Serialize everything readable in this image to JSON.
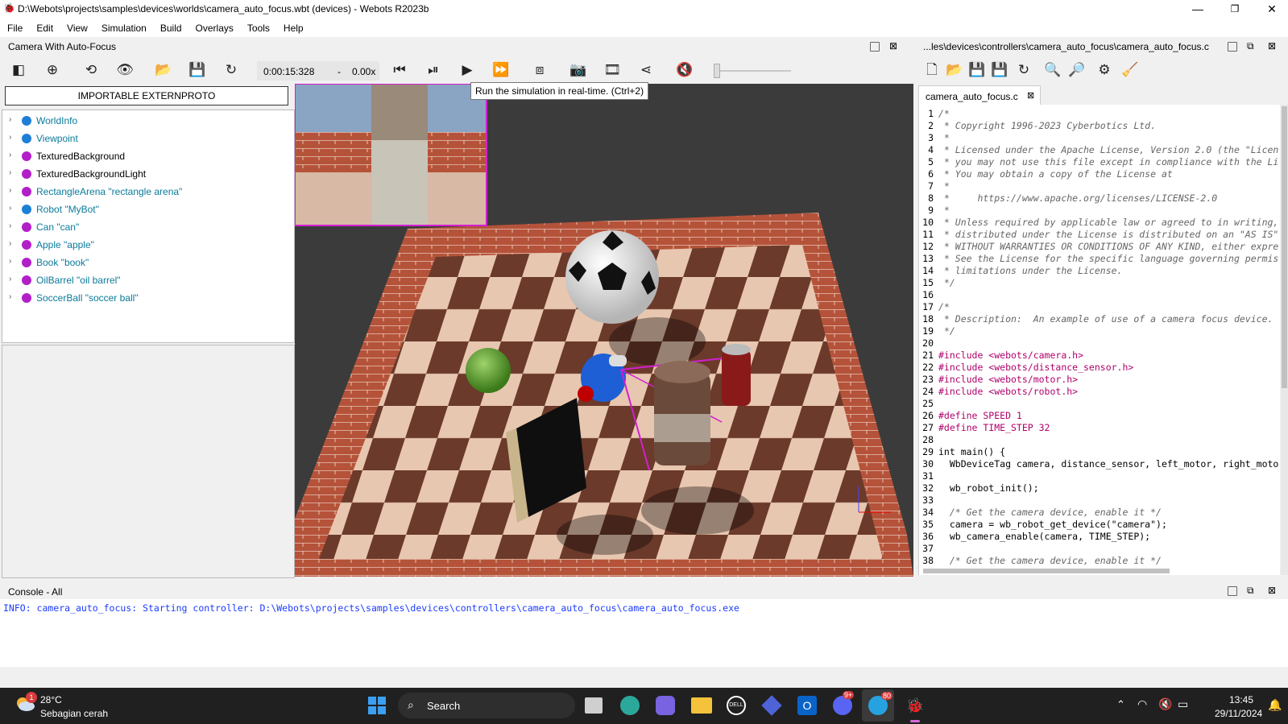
{
  "window": {
    "title": "D:\\Webots\\projects\\samples\\devices\\worlds\\camera_auto_focus.wbt (devices) - Webots R2023b",
    "minimize": "—",
    "maximize": "❐",
    "close": "✕"
  },
  "menu": [
    "File",
    "Edit",
    "View",
    "Simulation",
    "Build",
    "Overlays",
    "Tools",
    "Help"
  ],
  "scene_panel": {
    "title": "Camera With Auto-Focus",
    "importable_button": "IMPORTABLE EXTERNPROTO",
    "items": [
      {
        "label": "WorldInfo",
        "color": "#1e7fd6",
        "text_color": "#0a7a9a"
      },
      {
        "label": "Viewpoint",
        "color": "#1e7fd6",
        "text_color": "#0a7a9a"
      },
      {
        "label": "TexturedBackground",
        "color": "#b21fc9",
        "text_color": "#000000"
      },
      {
        "label": "TexturedBackgroundLight",
        "color": "#b21fc9",
        "text_color": "#000000"
      },
      {
        "label": "RectangleArena \"rectangle arena\"",
        "color": "#b21fc9",
        "text_color": "#0a7a9a"
      },
      {
        "label": "Robot \"MyBot\"",
        "color": "#1e7fd6",
        "text_color": "#0a7a9a"
      },
      {
        "label": "Can \"can\"",
        "color": "#b21fc9",
        "text_color": "#0a7a9a"
      },
      {
        "label": "Apple \"apple\"",
        "color": "#b21fc9",
        "text_color": "#0a7a9a"
      },
      {
        "label": "Book \"book\"",
        "color": "#b21fc9",
        "text_color": "#0a7a9a"
      },
      {
        "label": "OilBarrel \"oil barrel\"",
        "color": "#b21fc9",
        "text_color": "#0a7a9a"
      },
      {
        "label": "SoccerBall \"soccer ball\"",
        "color": "#b21fc9",
        "text_color": "#0a7a9a"
      }
    ]
  },
  "toolbar": {
    "time": "0:00:15:328",
    "separator": "-",
    "speed": "0.00x",
    "tooltip": "Run the simulation in real-time. (Ctrl+2)",
    "volume_level": 0.0
  },
  "editor": {
    "path": "...les\\devices\\controllers\\camera_auto_focus\\camera_auto_focus.c",
    "tab": "camera_auto_focus.c",
    "lines": [
      {
        "n": "1",
        "t": "/*",
        "k": "cm"
      },
      {
        "n": "2",
        "t": " * Copyright 1996-2023 Cyberbotics Ltd.",
        "k": "cm"
      },
      {
        "n": "3",
        "t": " *",
        "k": "cm"
      },
      {
        "n": "4",
        "t": " * Licensed under the Apache License, Version 2.0 (the \"Licen",
        "k": "cm"
      },
      {
        "n": "5",
        "t": " * you may not use this file except in compliance with the Li",
        "k": "cm"
      },
      {
        "n": "6",
        "t": " * You may obtain a copy of the License at",
        "k": "cm"
      },
      {
        "n": "7",
        "t": " *",
        "k": "cm"
      },
      {
        "n": "8",
        "t": " *     https://www.apache.org/licenses/LICENSE-2.0",
        "k": "cm"
      },
      {
        "n": "9",
        "t": " *",
        "k": "cm"
      },
      {
        "n": "10",
        "t": " * Unless required by applicable law or agreed to in writing,",
        "k": "cm"
      },
      {
        "n": "11",
        "t": " * distributed under the License is distributed on an \"AS IS\"",
        "k": "cm"
      },
      {
        "n": "12",
        "t": " * WITHOUT WARRANTIES OR CONDITIONS OF ANY KIND, either expre",
        "k": "cm"
      },
      {
        "n": "13",
        "t": " * See the License for the specific language governing permis",
        "k": "cm"
      },
      {
        "n": "14",
        "t": " * limitations under the License.",
        "k": "cm"
      },
      {
        "n": "15",
        "t": " */",
        "k": "cm"
      },
      {
        "n": "16",
        "t": "",
        "k": ""
      },
      {
        "n": "17",
        "t": "/*",
        "k": "cm"
      },
      {
        "n": "18",
        "t": " * Description:  An example of use of a camera focus device.",
        "k": "cm"
      },
      {
        "n": "19",
        "t": " */",
        "k": "cm"
      },
      {
        "n": "20",
        "t": "",
        "k": ""
      },
      {
        "n": "21",
        "t": "#include <webots/camera.h>",
        "k": "pp"
      },
      {
        "n": "22",
        "t": "#include <webots/distance_sensor.h>",
        "k": "pp"
      },
      {
        "n": "23",
        "t": "#include <webots/motor.h>",
        "k": "pp"
      },
      {
        "n": "24",
        "t": "#include <webots/robot.h>",
        "k": "pp"
      },
      {
        "n": "25",
        "t": "",
        "k": ""
      },
      {
        "n": "26",
        "t": "#define SPEED 1",
        "k": "pp"
      },
      {
        "n": "27",
        "t": "#define TIME_STEP 32",
        "k": "pp"
      },
      {
        "n": "28",
        "t": "",
        "k": ""
      },
      {
        "n": "29",
        "t": "int main() {",
        "k": "kw"
      },
      {
        "n": "30",
        "t": "  WbDeviceTag camera, distance_sensor, left_motor, right_motor",
        "k": "ty"
      },
      {
        "n": "31",
        "t": "",
        "k": ""
      },
      {
        "n": "32",
        "t": "  wb_robot_init();",
        "k": "fn"
      },
      {
        "n": "33",
        "t": "",
        "k": ""
      },
      {
        "n": "34",
        "t": "  /* Get the camera device, enable it */",
        "k": "cm"
      },
      {
        "n": "35",
        "t": "  camera = wb_robot_get_device(\"camera\");",
        "k": "fn"
      },
      {
        "n": "36",
        "t": "  wb_camera_enable(camera, TIME_STEP);",
        "k": "fn"
      },
      {
        "n": "37",
        "t": "",
        "k": ""
      },
      {
        "n": "38",
        "t": "  /* Get the camera device, enable it */",
        "k": "cm"
      }
    ]
  },
  "console": {
    "title": "Console - All",
    "line": "INFO: camera_auto_focus: Starting controller: D:\\Webots\\projects\\samples\\devices\\controllers\\camera_auto_focus\\camera_auto_focus.exe"
  },
  "taskbar": {
    "temperature": "28°C",
    "weather": "Sebagian cerah",
    "weather_badge": "1",
    "search": "Search",
    "time": "13:45",
    "date": "29/11/2024",
    "discord_badge": "9+",
    "telegram_badge": "80"
  }
}
